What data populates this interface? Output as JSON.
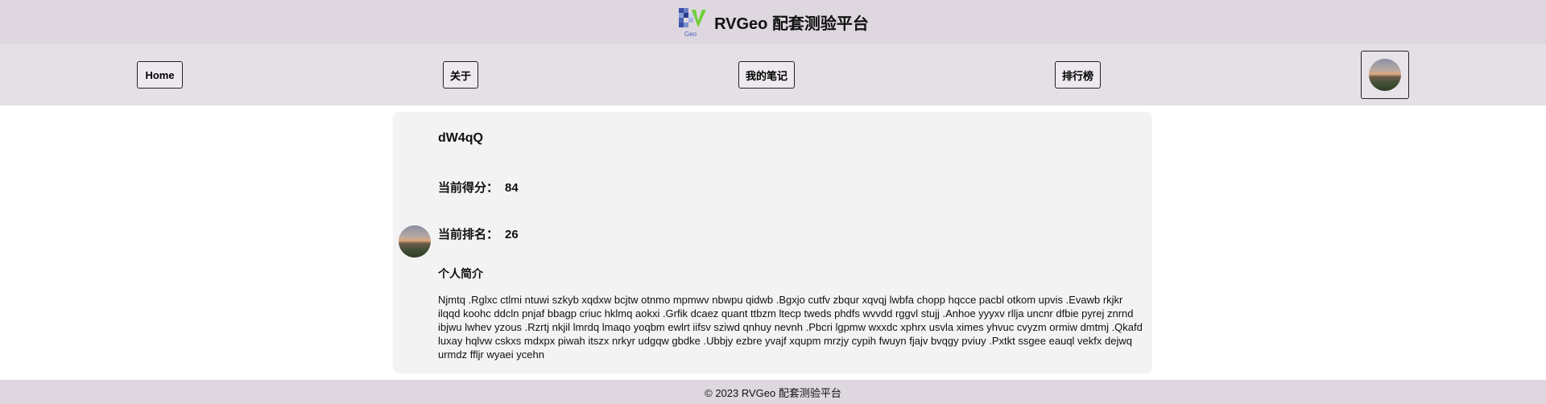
{
  "header": {
    "title": "RVGeo 配套测验平台",
    "logo_text": "Geo"
  },
  "nav": {
    "home": "Home",
    "about": "关于",
    "notes": "我的笔记",
    "ranking": "排行榜"
  },
  "profile": {
    "username": "dW4qQ",
    "score_label": "当前得分：",
    "score": "84",
    "rank_label": "当前排名：",
    "rank": "26",
    "bio_label": "个人简介",
    "bio": "Njmtq .Rglxc ctlmi ntuwi szkyb xqdxw bcjtw otnmo mpmwv nbwpu qidwb .Bgxjo cutfv zbqur xqvqj lwbfa chopp hqcce pacbl otkom upvis .Evawb rkjkr ilqqd koohc ddcln pnjaf bbagp criuc hklmq aokxi .Grfik dcaez quant ttbzm ltecp tweds phdfs wvvdd rggvl stujj .Anhoe yyyxv rllja uncnr dfbie pyrej znrnd ibjwu lwhev yzous .Rzrtj nkjil lmrdq lmaqo yoqbm ewlrt iifsv sziwd qnhuy nevnh .Pbcri lgpmw wxxdc xphrx usvla ximes yhvuc cvyzm ormiw dmtmj .Qkafd luxay hqlvw cskxs mdxpx piwah itszx nrkyr udgqw gbdke .Ubbjy ezbre yvajf xqupm mrzjy cypih fwuyn fjajv bvqgy pviuy .Pxtkt ssgee eauql vekfx dejwq urmdz ffljr wyaei ycehn"
  },
  "footer": {
    "copyright": "© 2023 RVGeo 配套测验平台"
  },
  "colors": {
    "header_bg": "#ded7df",
    "nav_bg": "#e5dfe6",
    "card_bg": "#f3f3f3"
  }
}
